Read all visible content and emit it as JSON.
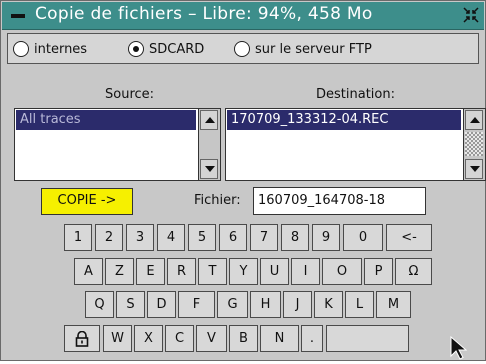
{
  "window": {
    "title": "Copie de fichiers – Libre: 94%, 458 Mo",
    "restore_icon": "restore-icon"
  },
  "source_options": {
    "items": [
      {
        "label": "internes",
        "selected": false
      },
      {
        "label": "SDCARD",
        "selected": true
      },
      {
        "label": "sur le serveur FTP",
        "selected": false
      }
    ]
  },
  "source": {
    "label": "Source:",
    "items": [
      "All traces"
    ]
  },
  "destination": {
    "label": "Destination:",
    "items": [
      "170709_133312-04.REC"
    ]
  },
  "copy_button": {
    "label": "COPIE ->"
  },
  "file": {
    "label": "Fichier:",
    "value": "160709_164708-18"
  },
  "keyboard": {
    "row1": [
      "1",
      "2",
      "3",
      "4",
      "5",
      "6",
      "7",
      "8",
      "9",
      "0",
      "<-"
    ],
    "row2": [
      "A",
      "Z",
      "E",
      "R",
      "T",
      "Y",
      "U",
      "I",
      "O",
      "P",
      "Ω"
    ],
    "row3": [
      "Q",
      "S",
      "D",
      "F",
      "G",
      "H",
      "J",
      "K",
      "L",
      "M"
    ],
    "row4": [
      "W",
      "X",
      "C",
      "V",
      "B",
      "N",
      "."
    ],
    "lock_icon": "lock-icon"
  },
  "colors": {
    "titlebar": "#3d8e8b",
    "selection": "#2b2b6b",
    "copy_button": "#f6f000"
  }
}
